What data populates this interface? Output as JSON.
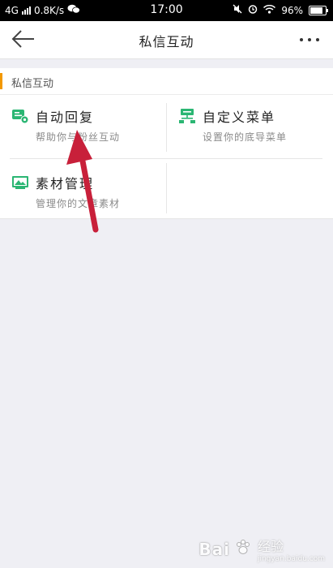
{
  "status_bar": {
    "network": "4G",
    "speed": "0.8K/s",
    "time": "17:00",
    "battery": "96%"
  },
  "nav": {
    "title": "私信互动"
  },
  "section": {
    "title": "私信互动"
  },
  "items": [
    {
      "label": "自动回复",
      "sub": "帮助你与粉丝互动",
      "icon": "auto-reply-icon"
    },
    {
      "label": "自定义菜单",
      "sub": "设置你的底导菜单",
      "icon": "custom-menu-icon"
    },
    {
      "label": "素材管理",
      "sub": "管理你的文章素材",
      "icon": "material-icon"
    }
  ],
  "colors": {
    "accent": "#f39800",
    "icon_green": "#2bb673",
    "arrow_red": "#c8203a"
  },
  "watermark": {
    "logo": "Bai",
    "text": "经验",
    "sub": "jingyan.baidu.com"
  }
}
